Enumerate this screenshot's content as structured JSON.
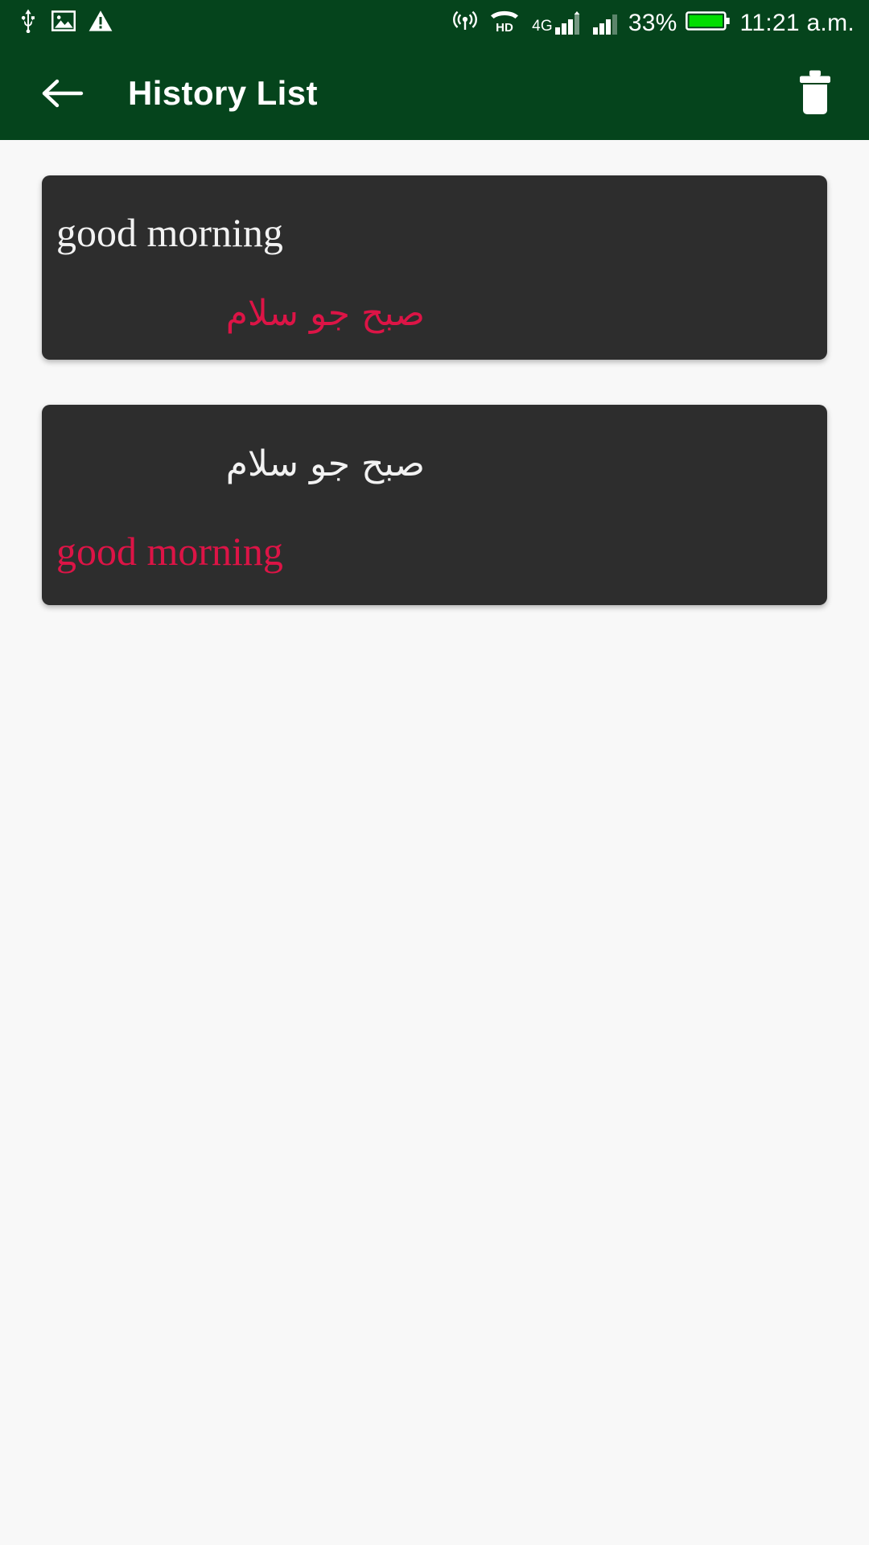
{
  "status_bar": {
    "background_color": "#05441c",
    "left_icons": [
      {
        "name": "usb-icon",
        "label": "USB"
      },
      {
        "name": "image-icon",
        "label": "Screenshot saved"
      },
      {
        "name": "warning-icon",
        "label": "Warning"
      }
    ],
    "right_icons": [
      {
        "name": "hotspot-icon",
        "label": "Hotspot"
      },
      {
        "name": "hd-voice-icon",
        "label": "HD"
      },
      {
        "name": "signal-sim1-icon",
        "label": "4G"
      },
      {
        "name": "signal-sim2-icon",
        "label": "Signal 2"
      },
      {
        "name": "battery-icon",
        "label": "Battery"
      }
    ],
    "network_label": "4G",
    "hd_label": "HD",
    "battery_percent": "33%",
    "battery_fill_color": "#00dd00",
    "time": "11:21 a.m."
  },
  "app_bar": {
    "background_color": "#05441c",
    "title": "History List",
    "back_label": "Back",
    "delete_label": "Delete history"
  },
  "history": {
    "items": [
      {
        "source_text": "good morning",
        "source_dir": "ltr",
        "source_color": "#f2f2f2",
        "translated_text": "صبح جو سلام",
        "translated_dir": "rtl",
        "translated_color": "#dc1446"
      },
      {
        "source_text": "صبح جو سلام",
        "source_dir": "rtl",
        "source_color": "#f2f2f2",
        "translated_text": "good morning",
        "translated_dir": "ltr",
        "translated_color": "#dc1446"
      }
    ]
  },
  "theme": {
    "page_background": "#f8f8f8",
    "card_background": "#2d2d2d",
    "accent_color": "#dc1446",
    "primary_color": "#05441c"
  }
}
